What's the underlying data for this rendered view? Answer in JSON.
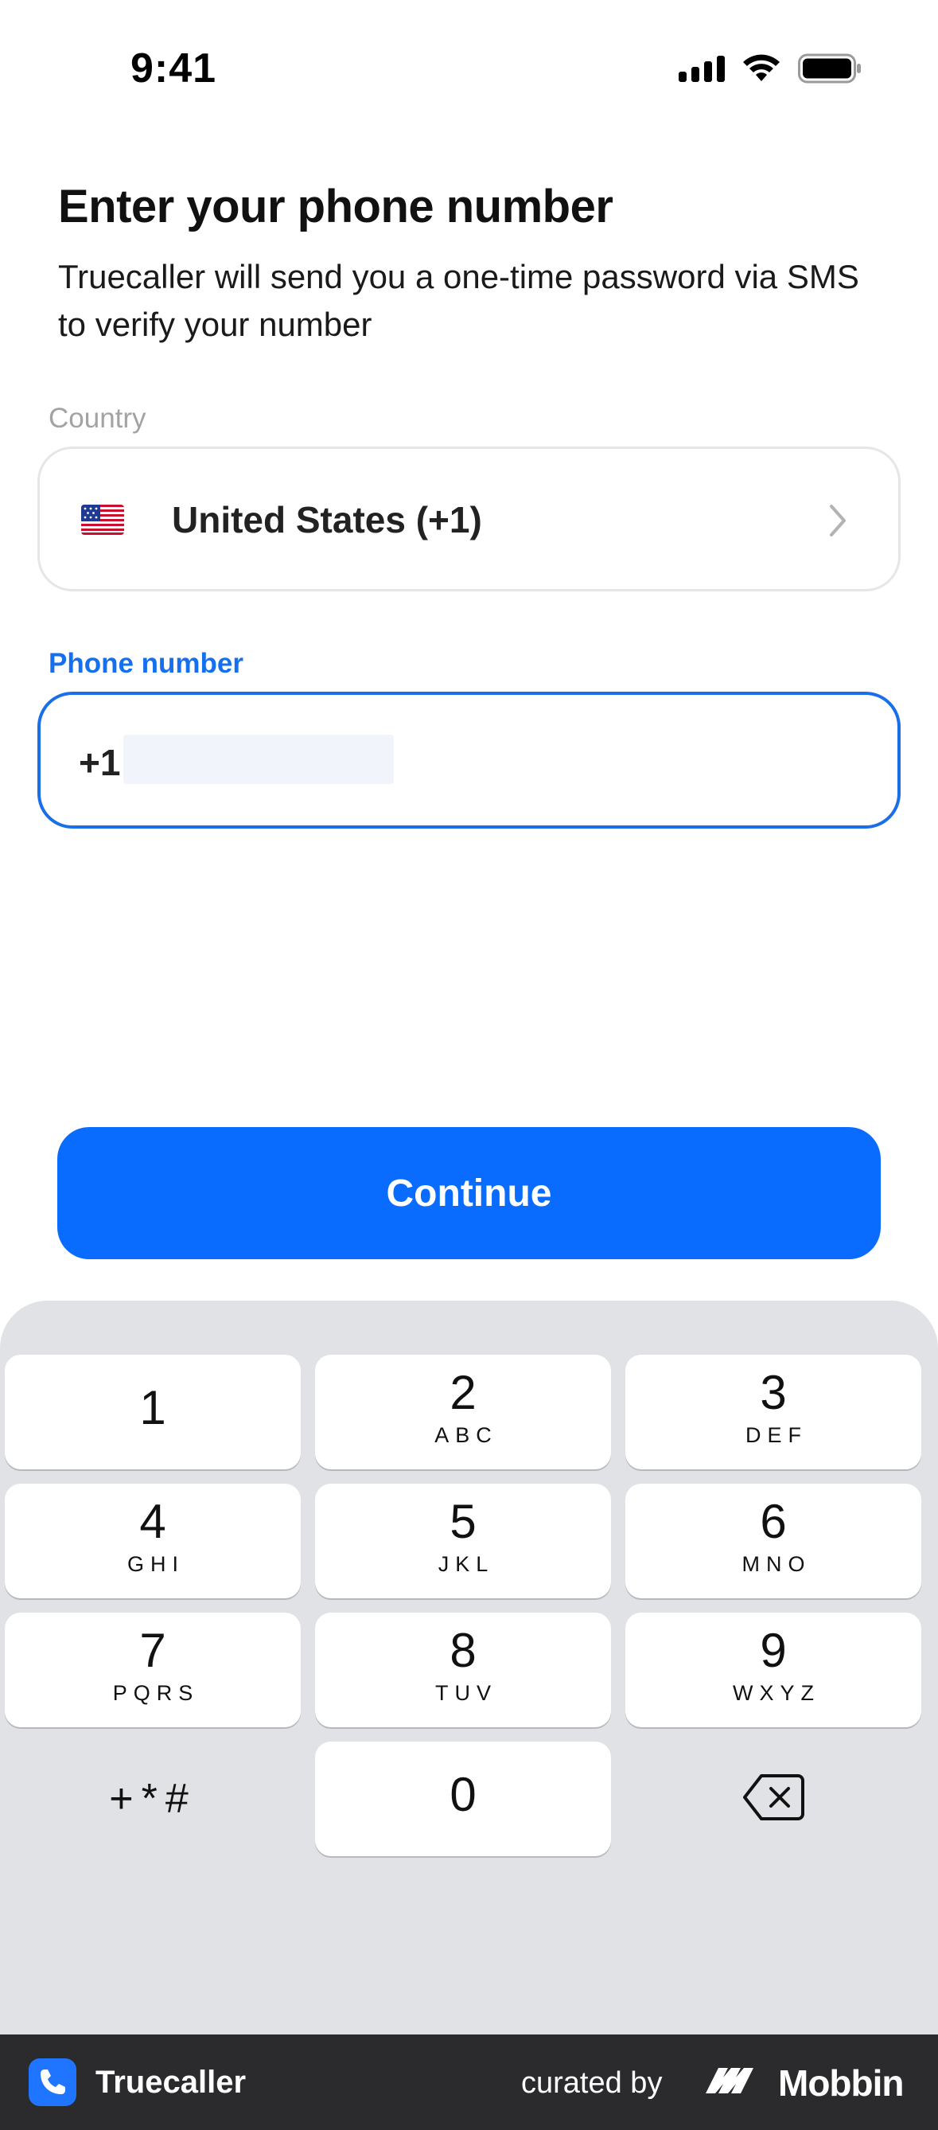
{
  "status_bar": {
    "time": "9:41"
  },
  "header": {
    "title": "Enter your phone number",
    "subtitle": "Truecaller will send you a one-time password via SMS to verify your number"
  },
  "country": {
    "label": "Country",
    "value": "United States (+1)",
    "flag_icon": "us-flag-icon"
  },
  "phone": {
    "label": "Phone number",
    "prefix": "+1",
    "number_redacted": true
  },
  "continue_button": {
    "label": "Continue"
  },
  "keypad": {
    "keys": [
      {
        "digit": "1",
        "letters": ""
      },
      {
        "digit": "2",
        "letters": "ABC"
      },
      {
        "digit": "3",
        "letters": "DEF"
      },
      {
        "digit": "4",
        "letters": "GHI"
      },
      {
        "digit": "5",
        "letters": "JKL"
      },
      {
        "digit": "6",
        "letters": "MNO"
      },
      {
        "digit": "7",
        "letters": "PQRS"
      },
      {
        "digit": "8",
        "letters": "TUV"
      },
      {
        "digit": "9",
        "letters": "WXYZ"
      },
      {
        "digit": "0",
        "letters": ""
      }
    ],
    "symbols": "+*#",
    "delete_icon": "backspace-icon"
  },
  "footer": {
    "app_name": "Truecaller",
    "curated_by": "curated by",
    "brand": "Mobbin"
  },
  "colors": {
    "accent": "#0a6cff",
    "label_active": "#1570ef",
    "keypad_bg": "#e1e2e6",
    "footer_bg": "#2b2b2d"
  }
}
